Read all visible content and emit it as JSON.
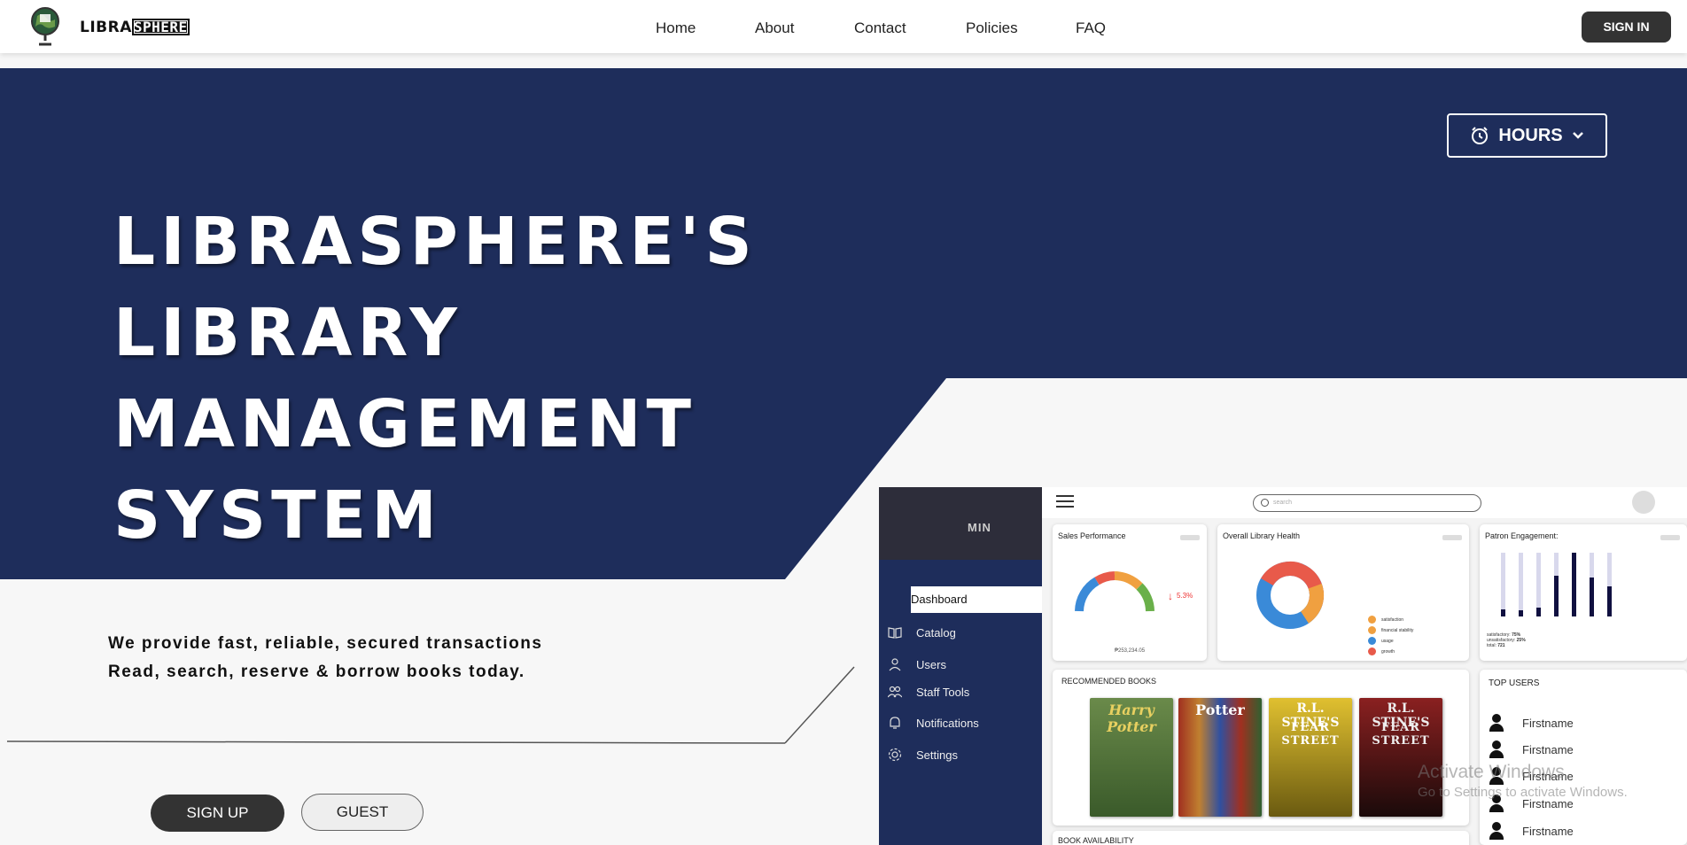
{
  "brand": {
    "prefix": "LIBRA",
    "suffix": "SPHERE"
  },
  "nav": {
    "links": [
      "Home",
      "About",
      "Contact",
      "Policies",
      "FAQ"
    ],
    "signin_label": "SIGN IN"
  },
  "hero": {
    "hours_label": "HOURS",
    "title_lines": [
      "LIBRASPHERE'S LIBRARY",
      "MANAGEMENT",
      "SYSTEM"
    ],
    "taglines": [
      "We provide fast, reliable, secured transactions",
      "Read, search, reserve & borrow books today."
    ],
    "signup_label": "SIGN UP",
    "guest_label": "GUEST"
  },
  "dashboard": {
    "admin_label": "MIN",
    "sidebar": [
      "Dashboard",
      "Catalog",
      "Users",
      "Staff Tools",
      "Notifications",
      "Settings"
    ],
    "search_placeholder": "search",
    "sales_title": "Sales Performance",
    "sales_change": "5.3%",
    "sales_total": "₱253,234.05",
    "health_title": "Overall Library Health",
    "health_legend": [
      "satisfaction",
      "financial stability",
      "usage",
      "growth"
    ],
    "patron_title": "Patron Engagement:",
    "patron_stats": [
      {
        "label": "satisfactory:",
        "value": "75%"
      },
      {
        "label": "unsatisfactory:",
        "value": "25%"
      },
      {
        "label": "total:",
        "value": "721"
      }
    ],
    "recommended_title": "RECOMMENDED BOOKS",
    "top_users_title": "TOP USERS",
    "top_users": [
      "Firstname",
      "Firstname",
      "Firstname",
      "Firstname",
      "Firstname"
    ],
    "availability_title": "BOOK AVAILABILITY",
    "books": [
      {
        "title": "Harry Potter",
        "color": "#5c7a3a"
      },
      {
        "title": "Potter",
        "color": "#8a3a2a"
      },
      {
        "title": "R.L. STINE'S",
        "subtitle": "FEAR STREET",
        "color": "#c9b12a"
      },
      {
        "title": "R.L. STINE'S",
        "subtitle": "FEAR STREET",
        "color": "#7a1a1a"
      }
    ]
  },
  "watermark": {
    "line1": "Activate Windows",
    "line2": "Go to Settings to activate Windows."
  },
  "colors": {
    "navy": "#1e2d5b",
    "dark_button": "#333333",
    "page_bg": "#f7f7f7"
  }
}
